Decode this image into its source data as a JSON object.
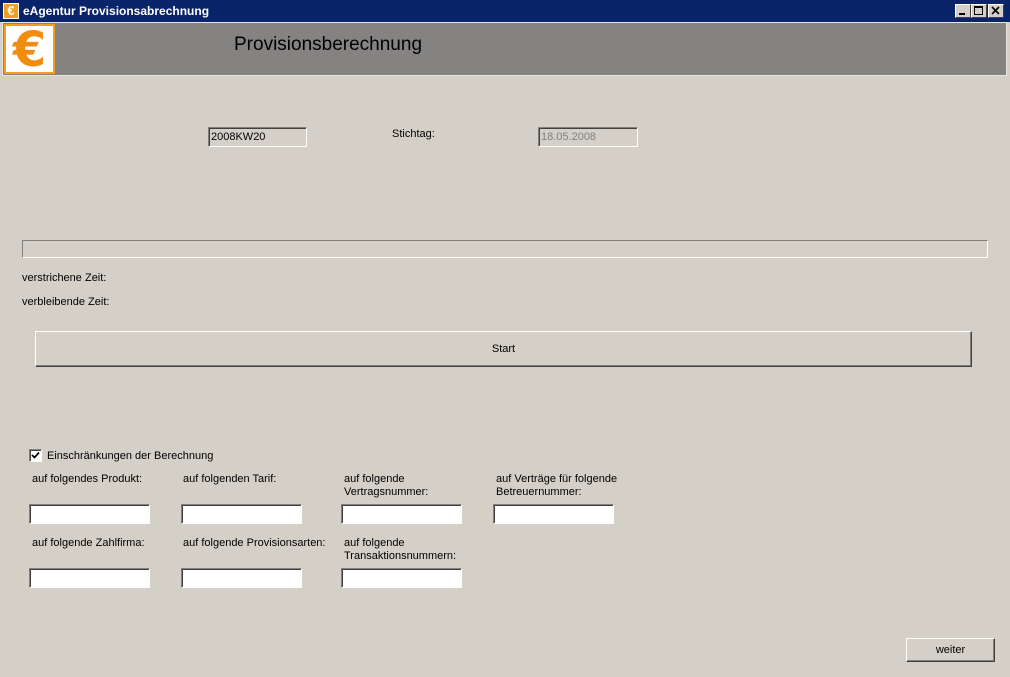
{
  "window": {
    "title": "eAgentur Provisionsabrechnung",
    "icon": "euro-icon"
  },
  "header": {
    "title": "Provisionsberechnung",
    "logo": "euro-logo"
  },
  "period": {
    "value": "2008KW20"
  },
  "stichtag": {
    "label": "Stichtag:",
    "value": "18.05.2008"
  },
  "progress": {
    "percent": 0
  },
  "time": {
    "elapsed_label": "verstrichene Zeit:",
    "remaining_label": "verbleibende Zeit:"
  },
  "start_button": "Start",
  "restrictions": {
    "checkbox_label": "Einschränkungen der Berechnung",
    "checked": true,
    "fields": {
      "produkt": {
        "label": "auf folgendes Produkt:",
        "value": ""
      },
      "tarif": {
        "label": "auf folgenden Tarif:",
        "value": ""
      },
      "vertragsnummer": {
        "label_line1": "auf folgende",
        "label_line2": "Vertragsnummer:",
        "value": ""
      },
      "betreuernummer": {
        "label_line1": "auf Verträge für folgende",
        "label_line2": "Betreuernummer:",
        "value": ""
      },
      "zahlfirma": {
        "label": "auf folgende Zahlfirma:",
        "value": ""
      },
      "provisionsarten": {
        "label": "auf folgende Provisionsarten:",
        "value": ""
      },
      "transaktionsnummern": {
        "label_line1": "auf folgende",
        "label_line2": "Transaktionsnummern:",
        "value": ""
      }
    }
  },
  "next_button": "weiter",
  "colors": {
    "titlebar": "#0a246a",
    "header_band": "#858282",
    "logo_accent": "#f08c10",
    "background": "#d4d0c8"
  }
}
